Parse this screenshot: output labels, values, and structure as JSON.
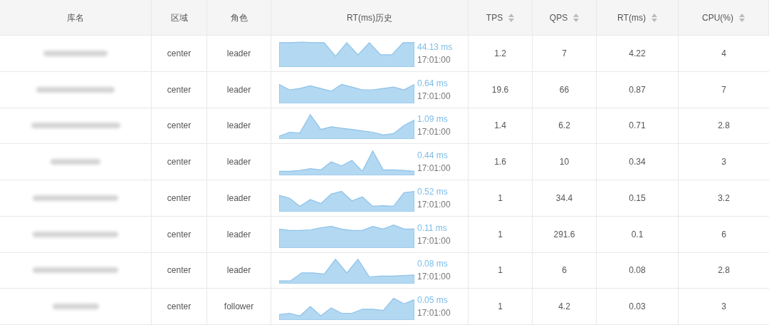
{
  "table": {
    "columns": [
      {
        "label": "库名",
        "sortable": false
      },
      {
        "label": "区域",
        "sortable": false
      },
      {
        "label": "角色",
        "sortable": false
      },
      {
        "label": "RT(ms)历史",
        "sortable": false
      },
      {
        "label": "TPS",
        "sortable": true
      },
      {
        "label": "QPS",
        "sortable": true
      },
      {
        "label": "RT(ms)",
        "sortable": true
      },
      {
        "label": "CPU(%)",
        "sortable": true
      }
    ],
    "rows": [
      {
        "region": "center",
        "role": "leader",
        "rt_latest": "44.13 ms",
        "rt_time": "17:01:00",
        "tps": "1.2",
        "qps": "7",
        "rt": "4.22",
        "cpu": "4"
      },
      {
        "region": "center",
        "role": "leader",
        "rt_latest": "0.64 ms",
        "rt_time": "17:01:00",
        "tps": "19.6",
        "qps": "66",
        "rt": "0.87",
        "cpu": "7"
      },
      {
        "region": "center",
        "role": "leader",
        "rt_latest": "1.09 ms",
        "rt_time": "17:01:00",
        "tps": "1.4",
        "qps": "6.2",
        "rt": "0.71",
        "cpu": "2.8"
      },
      {
        "region": "center",
        "role": "leader",
        "rt_latest": "0.44 ms",
        "rt_time": "17:01:00",
        "tps": "1.6",
        "qps": "10",
        "rt": "0.34",
        "cpu": "3"
      },
      {
        "region": "center",
        "role": "leader",
        "rt_latest": "0.52 ms",
        "rt_time": "17:01:00",
        "tps": "1",
        "qps": "34.4",
        "rt": "0.15",
        "cpu": "3.2"
      },
      {
        "region": "center",
        "role": "leader",
        "rt_latest": "0.11 ms",
        "rt_time": "17:01:00",
        "tps": "1",
        "qps": "291.6",
        "rt": "0.1",
        "cpu": "6"
      },
      {
        "region": "center",
        "role": "leader",
        "rt_latest": "0.08 ms",
        "rt_time": "17:01:00",
        "tps": "1",
        "qps": "6",
        "rt": "0.08",
        "cpu": "2.8"
      },
      {
        "region": "center",
        "role": "follower",
        "rt_latest": "0.05 ms",
        "rt_time": "17:01:00",
        "tps": "1",
        "qps": "4.2",
        "rt": "0.03",
        "cpu": "3"
      }
    ]
  }
}
